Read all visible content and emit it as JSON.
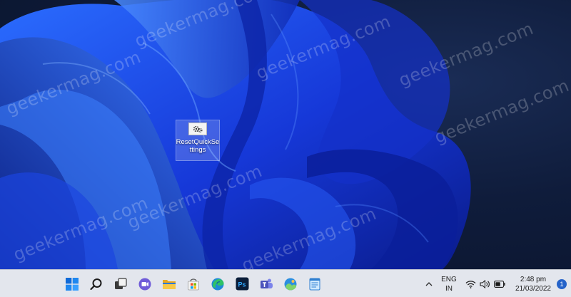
{
  "desktop": {
    "icon_label": "ResetQuickSettings",
    "watermark": "geekermag.com"
  },
  "taskbar": {
    "apps": [
      {
        "id": "start",
        "icon": "windows-start-icon"
      },
      {
        "id": "search",
        "icon": "search-icon"
      },
      {
        "id": "task-view",
        "icon": "task-view-icon"
      },
      {
        "id": "teams-chat",
        "icon": "teams-chat-icon"
      },
      {
        "id": "file-explorer",
        "icon": "file-explorer-icon"
      },
      {
        "id": "microsoft-store",
        "icon": "microsoft-store-icon"
      },
      {
        "id": "edge",
        "icon": "edge-browser-icon"
      },
      {
        "id": "photoshop",
        "icon": "photoshop-icon",
        "label": "Ps"
      },
      {
        "id": "teams",
        "icon": "teams-icon"
      },
      {
        "id": "photos",
        "icon": "photos-icon"
      },
      {
        "id": "notepad",
        "icon": "notepad-icon"
      }
    ],
    "tray": {
      "language": "ENG",
      "region": "IN",
      "time": "2:48 pm",
      "date": "21/03/2022",
      "notification_count": "1"
    }
  },
  "colors": {
    "accent": "#2563c9",
    "taskbar": "#e3e6ed",
    "wallpaper_dark": "#0b1733",
    "wallpaper_blue": "#1f4ff2"
  }
}
